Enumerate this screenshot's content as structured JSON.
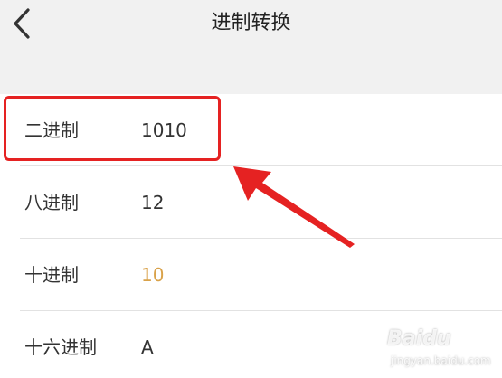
{
  "header": {
    "title": "进制转换",
    "back_icon": "chevron-left-icon"
  },
  "rows": [
    {
      "label": "二进制",
      "value": "1010",
      "value_color": "#333333"
    },
    {
      "label": "八进制",
      "value": "12",
      "value_color": "#333333"
    },
    {
      "label": "十进制",
      "value": "10",
      "value_color": "#d9a24a"
    },
    {
      "label": "十六进制",
      "value": "A",
      "value_color": "#333333"
    }
  ],
  "annotation": {
    "color": "#e52222"
  },
  "watermark": {
    "main": "Baidu",
    "sub": "jingyan.baidu.com"
  }
}
